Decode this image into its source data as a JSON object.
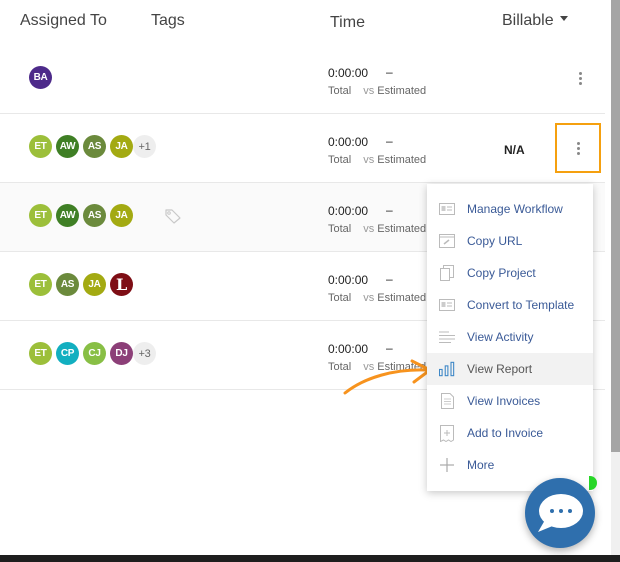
{
  "header": {
    "assigned_to": "Assigned To",
    "tags": "Tags",
    "time": "Time",
    "billable": "Billable"
  },
  "rows": [
    {
      "avatars": [
        {
          "initials": "BA",
          "color": "#4d2a8a"
        }
      ],
      "more": "",
      "time_total": "0:00:00",
      "time_estimated": "–",
      "total_label": "Total",
      "vs_label": "vs",
      "estimated_label": "Estimated",
      "billable": ""
    },
    {
      "avatars": [
        {
          "initials": "ET",
          "color": "#9cbf3a"
        },
        {
          "initials": "AW",
          "color": "#3f7f25"
        },
        {
          "initials": "AS",
          "color": "#6b8a3c"
        },
        {
          "initials": "JA",
          "color": "#a3aa12"
        }
      ],
      "more": "+1",
      "time_total": "0:00:00",
      "time_estimated": "–",
      "total_label": "Total",
      "vs_label": "vs",
      "estimated_label": "Estimated",
      "billable": "N/A"
    },
    {
      "avatars": [
        {
          "initials": "ET",
          "color": "#9cbf3a"
        },
        {
          "initials": "AW",
          "color": "#3f7f25"
        },
        {
          "initials": "AS",
          "color": "#6b8a3c"
        },
        {
          "initials": "JA",
          "color": "#a3aa12"
        }
      ],
      "more": "",
      "time_total": "0:00:00",
      "time_estimated": "–",
      "total_label": "Total",
      "vs_label": "vs",
      "estimated_label": "Estimated",
      "billable": ""
    },
    {
      "avatars": [
        {
          "initials": "ET",
          "color": "#9cbf3a"
        },
        {
          "initials": "AS",
          "color": "#6b8a3c"
        },
        {
          "initials": "JA",
          "color": "#a3aa12"
        },
        {
          "initials": "L",
          "color": "#7e0e15"
        }
      ],
      "more": "",
      "time_total": "0:00:00",
      "time_estimated": "–",
      "total_label": "Total",
      "vs_label": "vs",
      "estimated_label": "Estimated",
      "billable": ""
    },
    {
      "avatars": [
        {
          "initials": "ET",
          "color": "#9cbf3a"
        },
        {
          "initials": "CP",
          "color": "#12afc0"
        },
        {
          "initials": "CJ",
          "color": "#88bf45"
        },
        {
          "initials": "DJ",
          "color": "#8c3f78"
        }
      ],
      "more": "+3",
      "time_total": "0:00:00",
      "time_estimated": "–",
      "total_label": "Total",
      "vs_label": "vs",
      "estimated_label": "Estimated",
      "billable": ""
    }
  ],
  "menu": {
    "items": [
      {
        "label": "Manage Workflow",
        "icon": "workflow-icon"
      },
      {
        "label": "Copy URL",
        "icon": "link-icon"
      },
      {
        "label": "Copy Project",
        "icon": "copy-icon"
      },
      {
        "label": "Convert to Template",
        "icon": "template-icon"
      },
      {
        "label": "View Activity",
        "icon": "activity-icon"
      },
      {
        "label": "View Report",
        "icon": "bar-chart-icon",
        "highlighted": true
      },
      {
        "label": "View Invoices",
        "icon": "document-icon"
      },
      {
        "label": "Add to Invoice",
        "icon": "add-invoice-icon"
      },
      {
        "label": "More",
        "icon": "plus-icon"
      }
    ]
  },
  "colors": {
    "highlight_border": "#f5a00f",
    "annotation_arrow": "#f7931e",
    "menu_link": "#3a5a97",
    "chat_button": "#2f6fad",
    "online_indicator": "#27d627"
  }
}
